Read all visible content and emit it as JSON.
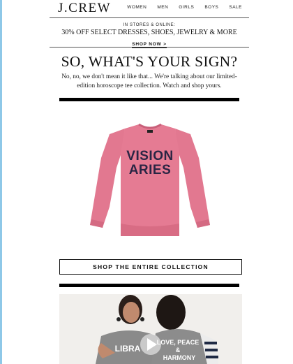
{
  "header": {
    "logo": "J.CREW",
    "nav": [
      "WOMEN",
      "MEN",
      "GIRLS",
      "BOYS",
      "SALE"
    ]
  },
  "promo": {
    "kicker": "IN STORES & ONLINE:",
    "headline": "30% OFF SELECT DRESSES, SHOES, JEWELRY & MORE",
    "cta": "SHOP NOW",
    "cta_arrow": ">"
  },
  "hero": {
    "title": "SO, WHAT'S YOUR SIGN?",
    "body": "No, no, we don't mean it like that... We're talking about our limited-edition horoscope tee collection. Watch and shop yours."
  },
  "product": {
    "line1": "VISION",
    "line2": "ARIES",
    "shirt_color": "#e57b93"
  },
  "cta_button": "SHOP THE ENTIRE COLLECTION",
  "video": {
    "tee_left": "LIBRA",
    "tee_right_1": "LOVE, PEACE",
    "tee_right_2": "&",
    "tee_right_3": "HARMONY"
  },
  "colors": {
    "accent_rule": "#8ec8e8",
    "bar": "#000000"
  }
}
